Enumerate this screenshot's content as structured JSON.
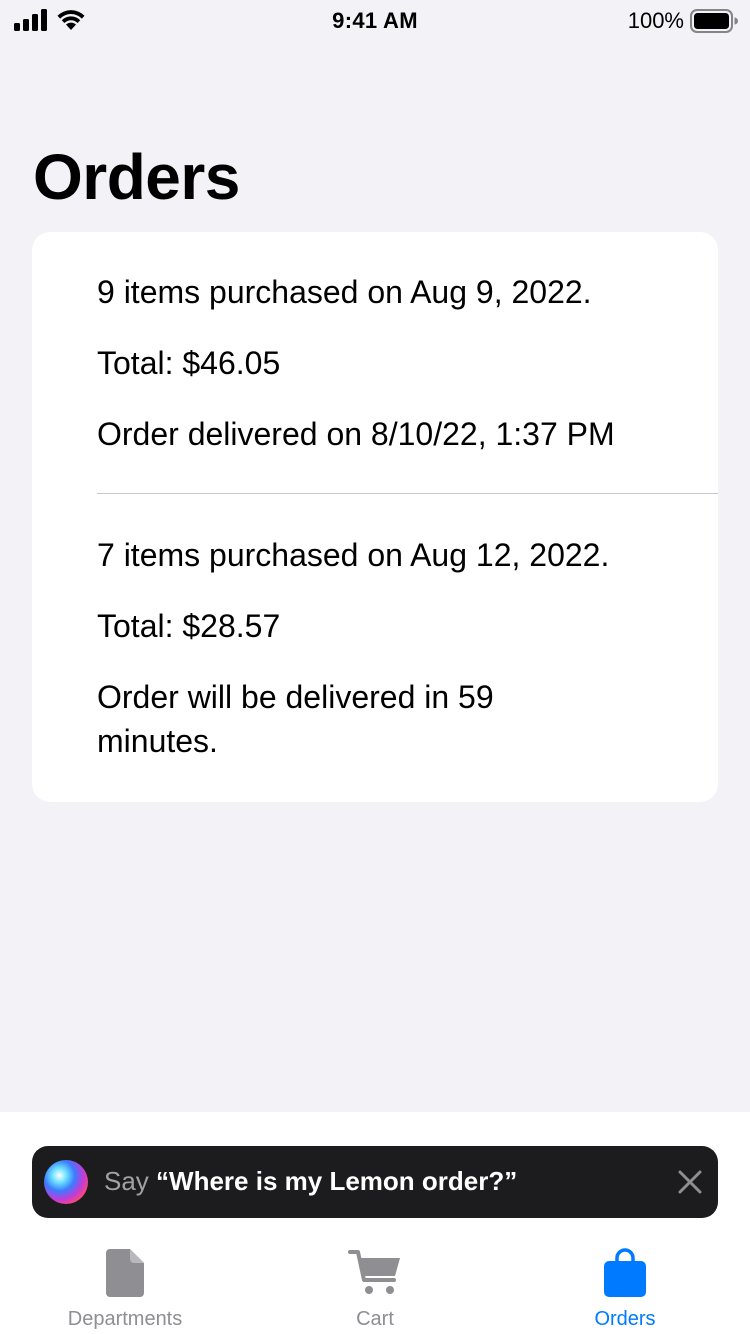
{
  "status_bar": {
    "time": "9:41 AM",
    "battery_percent": "100%"
  },
  "page": {
    "title": "Orders"
  },
  "orders": [
    {
      "summary": "9 items purchased on Aug 9, 2022.",
      "total": "Total: $46.05",
      "status": "Order delivered on 8/10/22, 1:37 PM"
    },
    {
      "summary": "7 items purchased on Aug 12, 2022.",
      "total": "Total: $28.57",
      "status": "Order will be delivered in 59 minutes."
    }
  ],
  "siri_suggestion": {
    "say": "Say",
    "phrase": "“Where is my Lemon order?”"
  },
  "tab_bar": {
    "active": "orders",
    "colors": {
      "active": "#007aff",
      "inactive": "#8e8e93"
    },
    "tabs": [
      {
        "label": "Departments",
        "icon": "document-icon"
      },
      {
        "label": "Cart",
        "icon": "cart-icon"
      },
      {
        "label": "Orders",
        "icon": "bag-icon"
      }
    ]
  }
}
